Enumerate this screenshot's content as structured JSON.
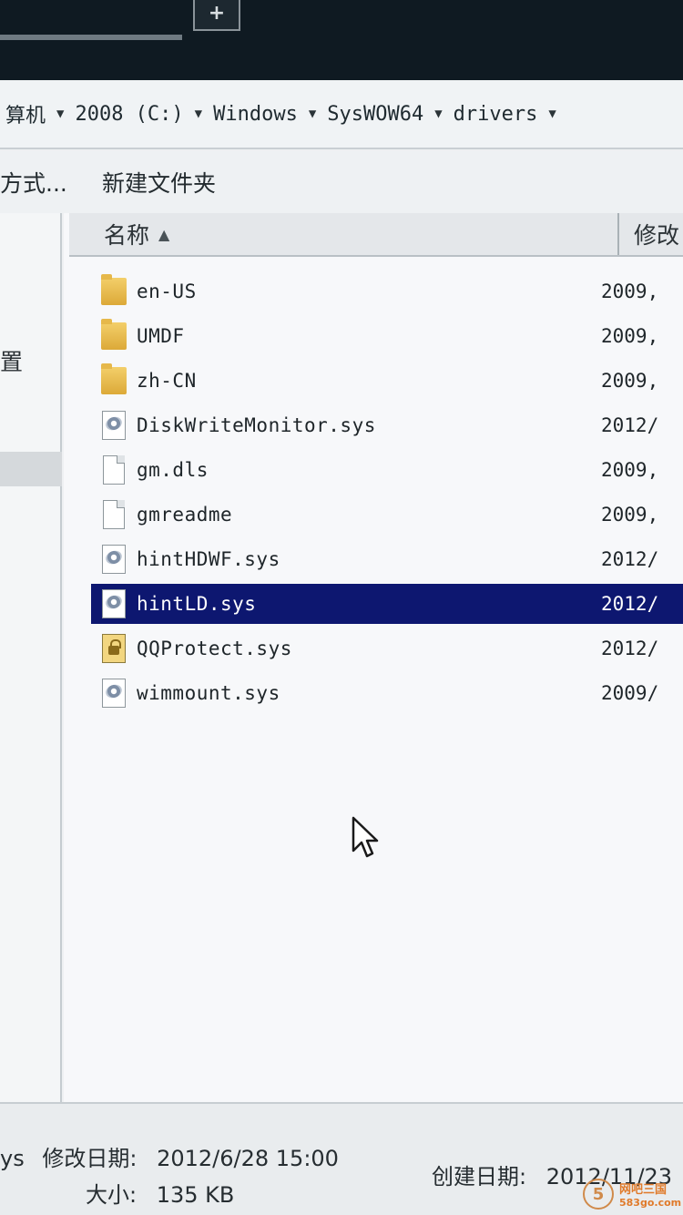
{
  "titlebar": {
    "button_glyph": "+"
  },
  "address": {
    "crumbs": [
      "算机",
      "2008 (C:)",
      "Windows",
      "SysWOW64",
      "drivers"
    ]
  },
  "toolbar": {
    "organize_partial": "方式...",
    "new_folder": "新建文件夹"
  },
  "navpane": {
    "item_partial": "置"
  },
  "columns": {
    "name": "名称",
    "modified_partial": "修改"
  },
  "files": [
    {
      "name": "en-US",
      "date": "2009,",
      "icon": "folder-icon"
    },
    {
      "name": "UMDF",
      "date": "2009,",
      "icon": "folder-icon"
    },
    {
      "name": "zh-CN",
      "date": "2009,",
      "icon": "folder-icon"
    },
    {
      "name": "DiskWriteMonitor.sys",
      "date": "2012/",
      "icon": "system-file-icon"
    },
    {
      "name": "gm.dls",
      "date": "2009,",
      "icon": "document-icon"
    },
    {
      "name": "gmreadme",
      "date": "2009,",
      "icon": "document-icon"
    },
    {
      "name": "hintHDWF.sys",
      "date": "2012/",
      "icon": "system-file-icon"
    },
    {
      "name": "hintLD.sys",
      "date": "2012/",
      "icon": "system-file-icon",
      "selected": true
    },
    {
      "name": "QQProtect.sys",
      "date": "2012/",
      "icon": "locked-file-icon"
    },
    {
      "name": "wimmount.sys",
      "date": "2009/",
      "icon": "system-file-icon"
    }
  ],
  "details": {
    "type_partial": "ys",
    "modified_label": "修改日期:",
    "modified_value": "2012/6/28 15:00",
    "size_label": "大小:",
    "size_value": "135 KB",
    "created_label": "创建日期:",
    "created_value": "2012/11/23"
  },
  "watermark": {
    "logo_glyph": "5",
    "line1": "网吧三国",
    "line2": "583go.com"
  },
  "colors": {
    "selection": "#0d1770",
    "folder": "#dca938"
  }
}
